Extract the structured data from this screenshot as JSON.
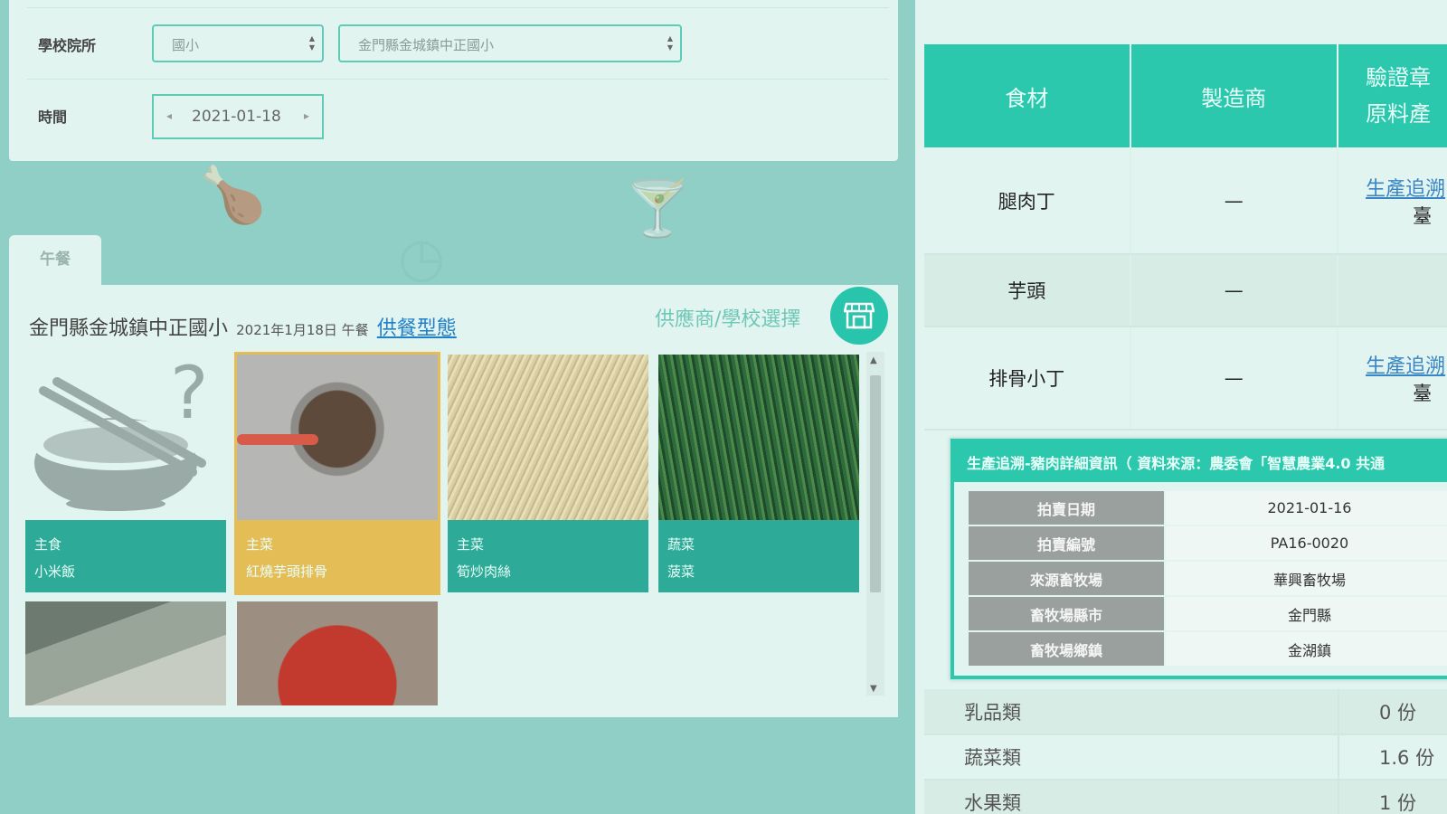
{
  "filters": {
    "school_label": "學校院所",
    "level_value": "國小",
    "school_value": "金門縣金城鎮中正國小",
    "time_label": "時間",
    "date_value": "2021-01-18",
    "prev_icon": "◂",
    "next_icon": "▸"
  },
  "meal": {
    "tab_label": "午餐",
    "school_name": "金門縣金城鎮中正國小",
    "date_text": "2021年1月18日 午餐",
    "type_link": "供餐型態",
    "supplier_label": "供應商/學校選擇",
    "dishes": [
      {
        "category": "主食",
        "name": "小米飯"
      },
      {
        "category": "主菜",
        "name": "紅燒芋頭排骨"
      },
      {
        "category": "主菜",
        "name": "筍炒肉絲"
      },
      {
        "category": "蔬菜",
        "name": "菠菜"
      }
    ]
  },
  "ingredients": {
    "headers": [
      "食材",
      "製造商",
      "驗證章\n原料產"
    ],
    "rows": [
      {
        "name": "腿肉丁",
        "maker": "—",
        "link": "生產追溯",
        "origin": "臺"
      },
      {
        "name": "芋頭",
        "maker": "—",
        "link": "",
        "origin": "—"
      },
      {
        "name": "排骨小丁",
        "maker": "—",
        "link": "生產追溯",
        "origin": "臺"
      }
    ]
  },
  "popup": {
    "title": "生產追溯-豬肉詳細資訊（ 資料來源：農委會「智慧農業4.0 共通",
    "rows": [
      {
        "key": "拍賣日期",
        "value": "2021-01-16"
      },
      {
        "key": "拍賣編號",
        "value": "PA16-0020"
      },
      {
        "key": "來源畜牧場",
        "value": "華興畜牧場"
      },
      {
        "key": "畜牧場縣市",
        "value": "金門縣"
      },
      {
        "key": "畜牧場鄉鎮",
        "value": "金湖鎮"
      }
    ]
  },
  "nutrition": [
    {
      "name": "乳品類",
      "value": "0 份"
    },
    {
      "name": "蔬菜類",
      "value": "1.6 份"
    },
    {
      "name": "水果類",
      "value": "1 份"
    }
  ],
  "colors": {
    "background": "#8fcfc5",
    "panel": "#e2f4ef",
    "accent": "#2cc8ae",
    "selected": "#e4bd57",
    "link": "#1f7fc9"
  }
}
